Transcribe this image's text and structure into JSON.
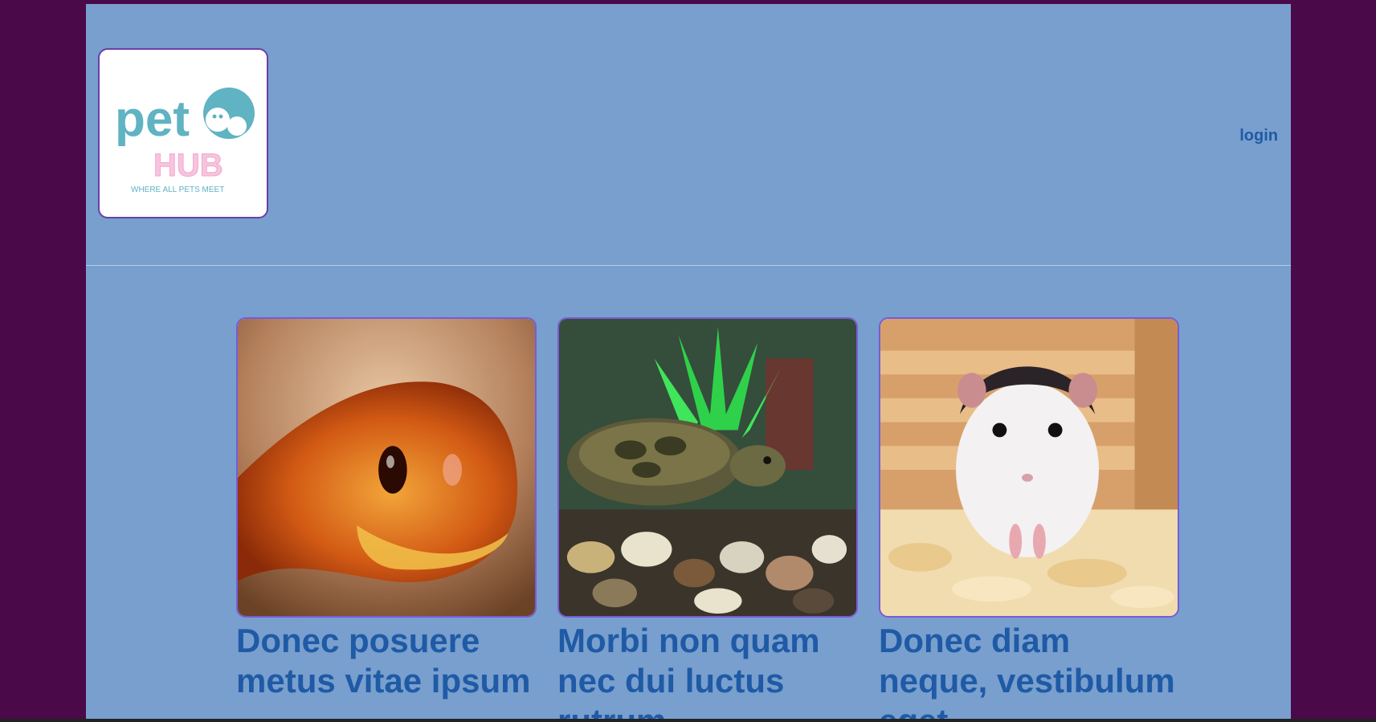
{
  "header": {
    "logo": {
      "word1": "pet",
      "word2": "HUB",
      "tagline": "WHERE ALL PETS MEET"
    },
    "login_label": "login"
  },
  "cards": [
    {
      "image": "snake-photo",
      "title": "Donec posuere metus vitae ipsum"
    },
    {
      "image": "turtle-photo",
      "title": "Morbi non quam nec dui luctus rutrum"
    },
    {
      "image": "hamster-photo",
      "title": "Donec diam neque, vestibulum eget"
    }
  ],
  "colors": {
    "background": "#4a0a4a",
    "panel": "#789fcd",
    "link": "#1f5aa6",
    "card_border": "#7a5bd6"
  }
}
